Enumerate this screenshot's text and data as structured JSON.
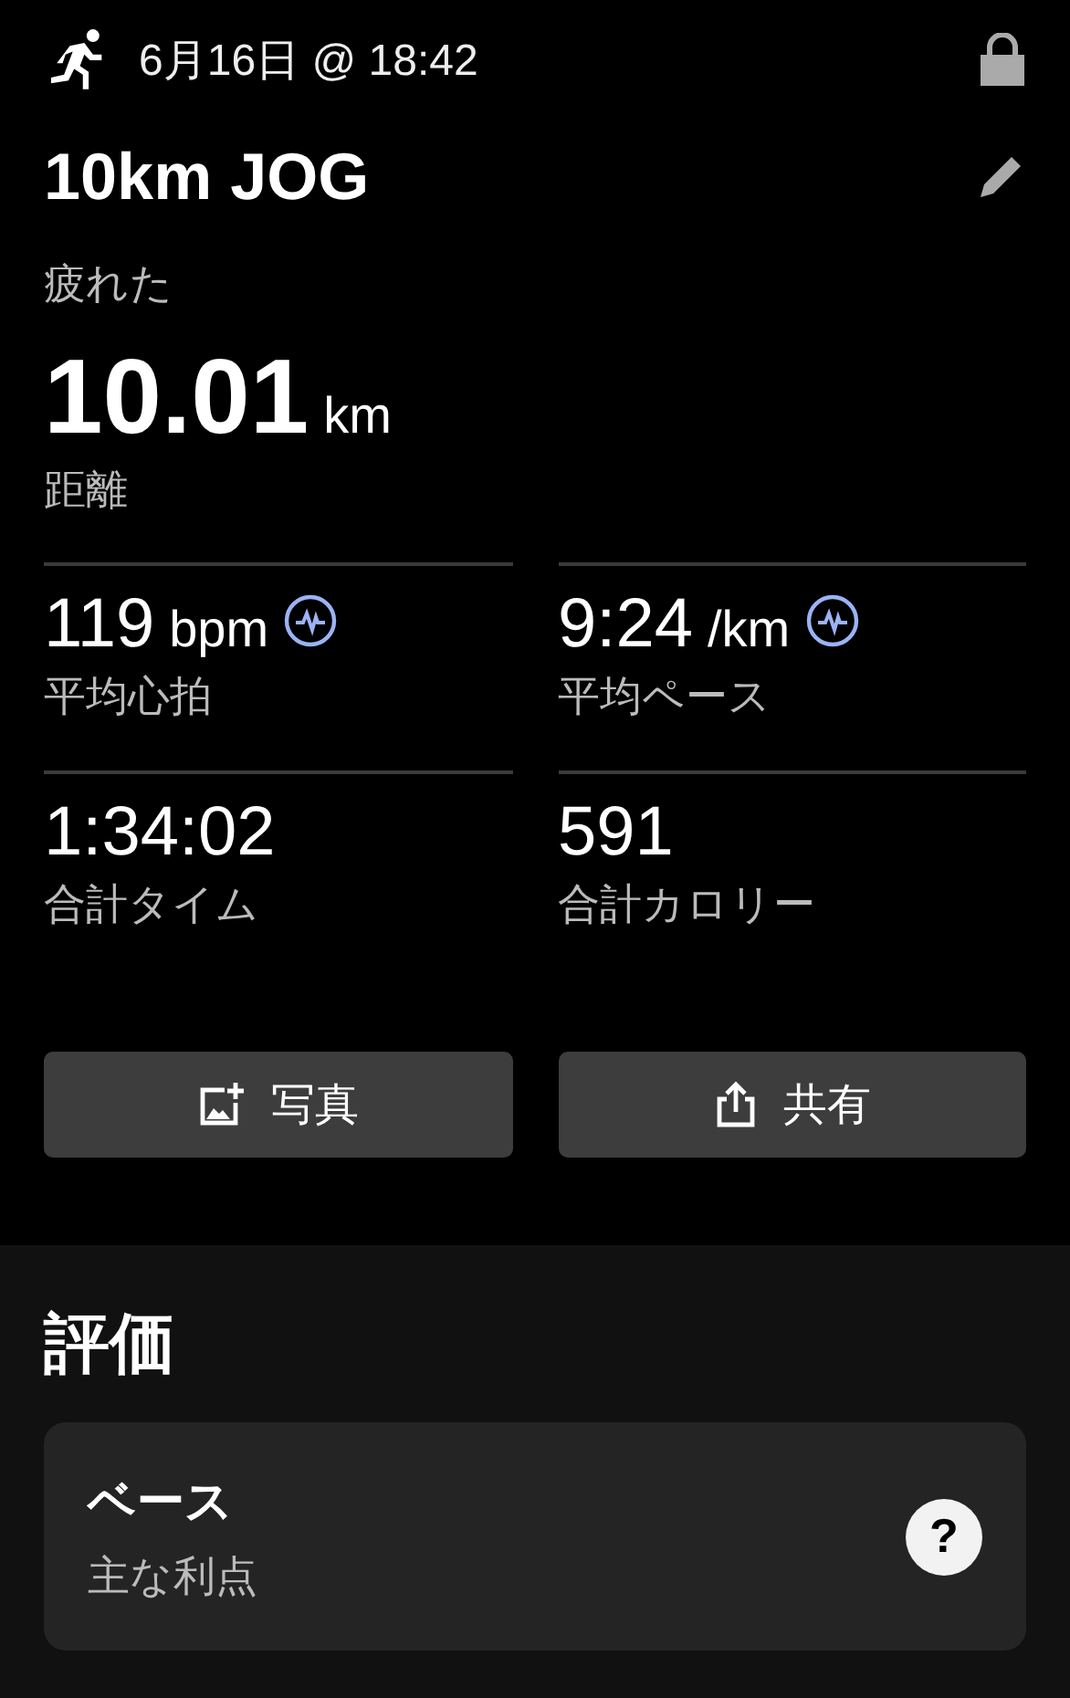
{
  "header": {
    "datetime": "6月16日 @ 18:42"
  },
  "activity": {
    "title": "10km JOG",
    "feeling": "疲れた"
  },
  "distance": {
    "value": "10.01",
    "unit": "km",
    "label": "距離"
  },
  "stats": [
    {
      "kind": "sensor",
      "value": "119",
      "unit": "bpm",
      "label": "平均心拍"
    },
    {
      "kind": "sensor",
      "value": "9:24",
      "unit": "/km",
      "label": "平均ペース"
    },
    {
      "kind": "plain",
      "value": "1:34:02",
      "label": "合計タイム"
    },
    {
      "kind": "plain",
      "value": "591",
      "label": "合計カロリー"
    }
  ],
  "buttons": [
    {
      "kind": "photo",
      "label": "写真"
    },
    {
      "kind": "share",
      "label": "共有"
    }
  ],
  "evaluation": {
    "heading": "評価",
    "card": {
      "title": "ベース",
      "subtitle": "主な利点",
      "help": "?"
    }
  }
}
